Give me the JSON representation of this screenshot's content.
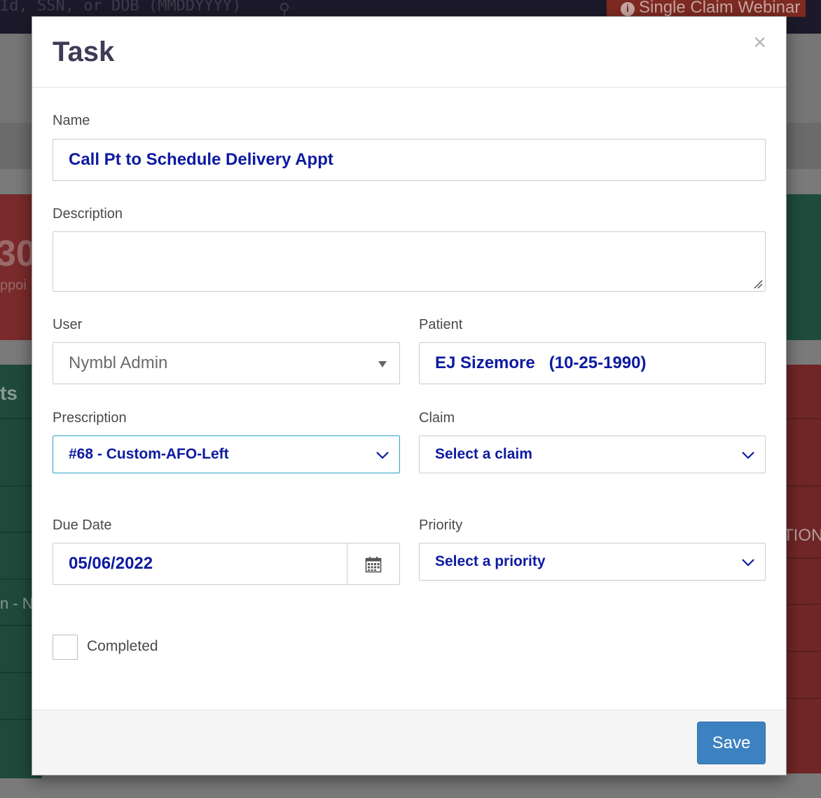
{
  "background": {
    "search_placeholder": "Id, SSN, or DOB (MMDDYYYY)",
    "webinar_label": "Single Claim Webinar",
    "fragments": [
      "30",
      "ppoi",
      "ts",
      "n - Ny",
      "TION"
    ]
  },
  "modal": {
    "title": "Task",
    "close_symbol": "×",
    "fields": {
      "name": {
        "label": "Name",
        "value": "Call Pt to Schedule Delivery Appt"
      },
      "description": {
        "label": "Description",
        "value": ""
      },
      "user": {
        "label": "User",
        "value": "Nymbl Admin"
      },
      "patient": {
        "label": "Patient",
        "value": "EJ Sizemore   (10-25-1990)"
      },
      "prescription": {
        "label": "Prescription",
        "value": "#68 - Custom-AFO-Left"
      },
      "claim": {
        "label": "Claim",
        "value": "Select a claim"
      },
      "due_date": {
        "label": "Due Date",
        "value": "05/06/2022"
      },
      "priority": {
        "label": "Priority",
        "value": "Select a priority"
      },
      "completed": {
        "label": "Completed",
        "checked": false
      }
    },
    "save_label": "Save"
  },
  "colors": {
    "title": "#3f3a56",
    "value_text": "#0d1aa0",
    "focus_border": "#2aa2c8",
    "save_button": "#3d82c0"
  },
  "icons": [
    "close-icon",
    "caret-down-icon",
    "chevron-down-icon",
    "calendar-icon",
    "resize-handle-icon",
    "search-icon",
    "info-icon"
  ]
}
